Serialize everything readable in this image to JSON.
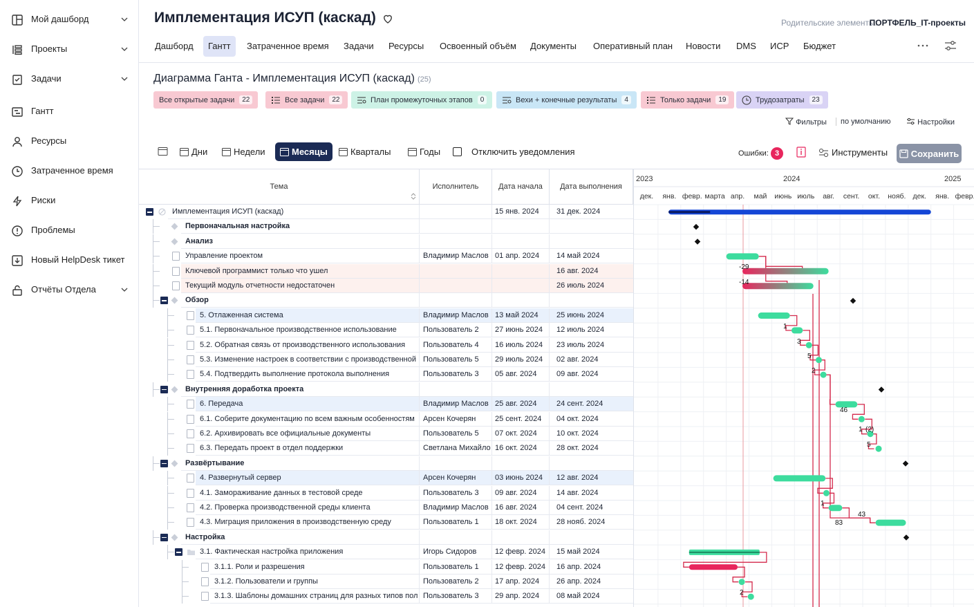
{
  "sidebar": {
    "items": [
      {
        "label": "Мой дашборд",
        "icon": "dashboard-icon",
        "chevron": true
      },
      {
        "label": "Проекты",
        "icon": "projects-icon",
        "chevron": true
      },
      {
        "label": "Задачи",
        "icon": "tasks-icon",
        "chevron": true
      },
      {
        "label": "Гантт",
        "icon": "gantt-icon",
        "chevron": false
      },
      {
        "label": "Ресурсы",
        "icon": "person-icon",
        "chevron": false
      },
      {
        "label": "Затраченное время",
        "icon": "clock-icon",
        "chevron": false
      },
      {
        "label": "Риски",
        "icon": "lightning-icon",
        "chevron": false
      },
      {
        "label": "Проблемы",
        "icon": "alert-icon",
        "chevron": false
      },
      {
        "label": "Новый HelpDesk тикет",
        "icon": "ticket-icon",
        "chevron": false
      },
      {
        "label": "Отчёты Отдела",
        "icon": "lock-icon",
        "chevron": true
      }
    ]
  },
  "header": {
    "title": "Имплементация ИСУП (каскад)",
    "parent_label": "Родительские элементы:",
    "parent_value": "ПОРТФЕЛЬ_IT-проекты",
    "tabs": [
      "Дашборд",
      "Гантт",
      "Затраченное время",
      "Задачи",
      "Ресурсы",
      "Освоенный объём",
      "Документы",
      "Оперативный план",
      "Новости",
      "DMS",
      "ИСР",
      "Бюджет"
    ],
    "active_tab": "Гантт"
  },
  "gantt": {
    "title": "Диаграмма Ганта - Имплементация ИСУП (каскад)",
    "title_count": "(25)",
    "chips": [
      {
        "label": "Все открытые задачи",
        "count": "22",
        "color": "#f8c9d2"
      },
      {
        "label": "Все задачи",
        "count": "22",
        "color": "#f8c9d2"
      },
      {
        "label": "План промежуточных этапов",
        "count": "0",
        "color": "#cdf2e6"
      },
      {
        "label": "Вехи + конечные результаты",
        "count": "4",
        "color": "#c9e6f6"
      },
      {
        "label": "Только задачи",
        "count": "19",
        "color": "#f8c9d2"
      },
      {
        "label": "Трудозатраты",
        "count": "23",
        "color": "#d9d3f5"
      }
    ],
    "filters_label": "Фильтры",
    "default_label": "по умолчанию",
    "settings_label": "Настройки",
    "zoom": [
      "Дни",
      "Недели",
      "Месяцы",
      "Кварталы",
      "Годы"
    ],
    "active_zoom": "Месяцы",
    "notify_label": "Отключить уведомления",
    "errors_label": "Ошибки:",
    "errors_count": "3",
    "tools_label": "Инструменты",
    "save_label": "Сохранить",
    "columns": {
      "topic": "Тема",
      "assignee": "Исполнитель",
      "start": "Дата начала",
      "due": "Дата выполнения"
    },
    "years": [
      "2023",
      "2024",
      "2025"
    ],
    "months": [
      "дек.",
      "янв.",
      "февр.",
      "марта",
      "апр.",
      "май",
      "июнь",
      "июль",
      "авг.",
      "сент.",
      "окт.",
      "нояб.",
      "дек.",
      "янв.",
      "февр."
    ],
    "rows": [
      {
        "topic": "Имплементация ИСУП (каскад)",
        "assignee": "",
        "start": "15 янв. 2024",
        "due": "31 дек. 2024"
      },
      {
        "topic": "Первоначальная настройка",
        "assignee": "",
        "start": "",
        "due": ""
      },
      {
        "topic": "Анализ",
        "assignee": "",
        "start": "",
        "due": ""
      },
      {
        "topic": "Управление проектом",
        "assignee": "Владимир Маслов",
        "start": "01 апр. 2024",
        "due": "14 май 2024"
      },
      {
        "topic": "Ключевой программист только что ушел",
        "assignee": "",
        "start": "",
        "due": "16 авг. 2024"
      },
      {
        "topic": "Текущий модуль отчетности недостаточен",
        "assignee": "",
        "start": "",
        "due": "26 июль 2024"
      },
      {
        "topic": "Обзор",
        "assignee": "",
        "start": "",
        "due": ""
      },
      {
        "topic": "5. Отлаженная система",
        "assignee": "Владимир Маслов",
        "start": "13 май 2024",
        "due": "25 июнь 2024"
      },
      {
        "topic": "5.1. Первоначальное производственное использование",
        "assignee": "Пользователь 2",
        "start": "27 июнь 2024",
        "due": "12 июль 2024"
      },
      {
        "topic": "5.2. Обратная связь от производственного использования",
        "assignee": "Пользователь 4",
        "start": "16 июль 2024",
        "due": "23 июль 2024"
      },
      {
        "topic": "5.3. Изменение настроек в соответствии с производственной",
        "assignee": "Пользователь 5",
        "start": "29 июль 2024",
        "due": "02 авг. 2024"
      },
      {
        "topic": "5.4. Подтвердить выполнение протокола выполнения",
        "assignee": "Пользователь 3",
        "start": "05 авг. 2024",
        "due": "09 авг. 2024"
      },
      {
        "topic": "Внутренняя доработка проекта",
        "assignee": "",
        "start": "",
        "due": ""
      },
      {
        "topic": "6. Передача",
        "assignee": "Владимир Маслов",
        "start": "25 авг. 2024",
        "due": "24 сент. 2024"
      },
      {
        "topic": "6.1. Соберите документацию по всем важным особенностям",
        "assignee": "Арсен Кочерян",
        "start": "25 сент. 2024",
        "due": "04 окт. 2024"
      },
      {
        "topic": "6.2. Архивировать все официальные документы",
        "assignee": "Пользователь 5",
        "start": "07 окт. 2024",
        "due": "10 окт. 2024"
      },
      {
        "topic": "6.3. Передать проект в отдел поддержки",
        "assignee": "Светлана Михайло",
        "start": "16 окт. 2024",
        "due": "28 окт. 2024"
      },
      {
        "topic": "Развёртывание",
        "assignee": "",
        "start": "",
        "due": ""
      },
      {
        "topic": "4. Развернутый сервер",
        "assignee": "Арсен Кочерян",
        "start": "03 июнь 2024",
        "due": "12 авг. 2024"
      },
      {
        "topic": "4.1. Замораживание данных в тестовой среде",
        "assignee": "Пользователь 3",
        "start": "09 авг. 2024",
        "due": "14 авг. 2024"
      },
      {
        "topic": "4.2. Проверка производственной среды клиента",
        "assignee": "Владимир Маслов",
        "start": "16 авг. 2024",
        "due": "04 сент. 2024"
      },
      {
        "topic": "4.3. Миграция приложения в производственную среду",
        "assignee": "Пользователь 1",
        "start": "18 окт. 2024",
        "due": "28 нояб. 2024"
      },
      {
        "topic": "Настройка",
        "assignee": "",
        "start": "",
        "due": ""
      },
      {
        "topic": "3.1. Фактическая настройка приложения",
        "assignee": "Игорь Сидоров",
        "start": "12 февр. 2024",
        "due": "15 май 2024"
      },
      {
        "topic": "3.1.1. Роли и разрешения",
        "assignee": "Пользователь 1",
        "start": "12 февр. 2024",
        "due": "16 апр. 2024"
      },
      {
        "topic": "3.1.2. Пользователи и группы",
        "assignee": "Пользователь 2",
        "start": "17 апр. 2024",
        "due": "26 апр. 2024"
      },
      {
        "topic": "3.1.3. Шаблоны домашних страниц для разных типов пол",
        "assignee": "Пользователь 3",
        "start": "29 апр. 2024",
        "due": "08 май 2024"
      }
    ],
    "link_labels": [
      "-29",
      "-14",
      "1",
      "3",
      "5",
      "2",
      "46",
      "1",
      "(2)",
      "5",
      "1",
      "43",
      "83",
      "2"
    ],
    "colors": {
      "accent": "#1b2b55",
      "bar_green": "#3ddc9e",
      "bar_pink": "#e8265d",
      "bar_blue": "#1446d6",
      "link": "#d42a4c"
    }
  }
}
